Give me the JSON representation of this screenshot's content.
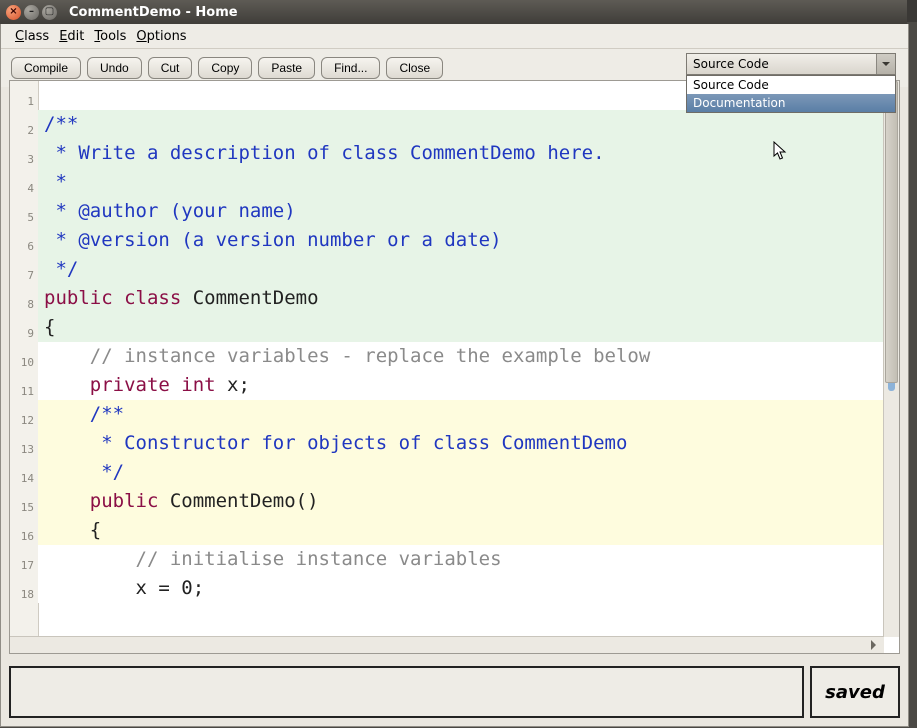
{
  "titlebar": {
    "title": "CommentDemo - Home"
  },
  "menubar": {
    "class_": "Class",
    "edit": "Edit",
    "tools": "Tools",
    "options": "Options"
  },
  "toolbar": {
    "compile": "Compile",
    "undo": "Undo",
    "cut": "Cut",
    "copy": "Copy",
    "paste": "Paste",
    "find": "Find...",
    "close": "Close"
  },
  "view_dropdown": {
    "selected": "Source Code",
    "options": [
      "Source Code",
      "Documentation"
    ],
    "highlighted_index": 1
  },
  "editor": {
    "line_numbers": [
      "1",
      "2",
      "3",
      "4",
      "5",
      "6",
      "7",
      "8",
      "9",
      "10",
      "11",
      "12",
      "13",
      "14",
      "15",
      "16",
      "17",
      "18"
    ],
    "l1": "/**",
    "l2": " * Write a description of class CommentDemo here.",
    "l3": " *",
    "l4": " * @author (your name)",
    "l5": " * @version (a version number or a date)",
    "l6": " */",
    "l7a": "public",
    "l7b": " class",
    "l7c": " CommentDemo",
    "l8": "{",
    "l9": "    // instance variables - replace the example below",
    "l10a": "    private",
    "l10b": " int",
    "l10c": " x;",
    "l11": "",
    "l12": "    /**",
    "l13": "     * Constructor for objects of class CommentDemo",
    "l14": "     */",
    "l15a": "    public",
    "l15b": " CommentDemo()",
    "l16": "    {",
    "l17": "        // initialise instance variables",
    "l18": "        x = 0;"
  },
  "status": {
    "saved": "saved"
  }
}
